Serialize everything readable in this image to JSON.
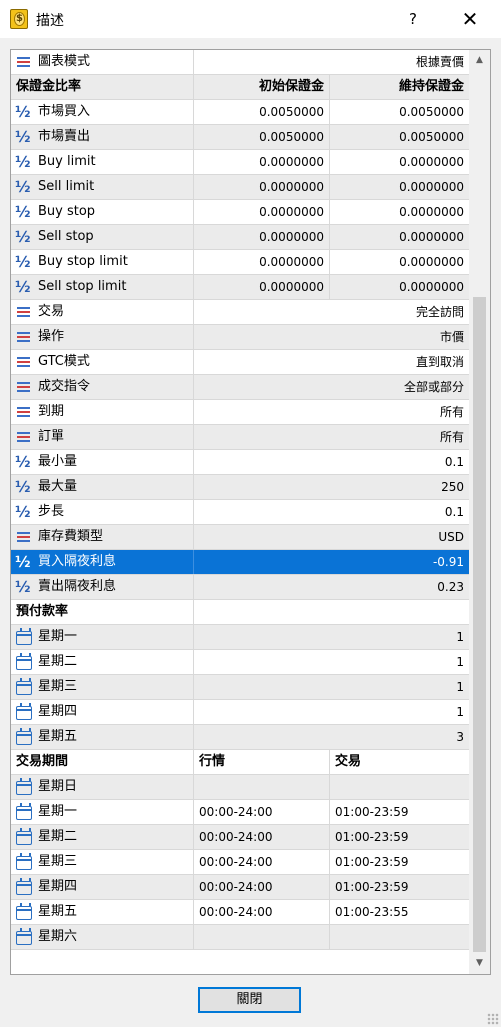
{
  "window": {
    "title": "描述",
    "help_label": "?",
    "close_label": "✕"
  },
  "rows": [
    {
      "kind": "prop",
      "icon": "list",
      "name": "圖表模式",
      "value": "根據賣價"
    },
    {
      "kind": "header",
      "name": "保證金比率",
      "a": "初始保證金",
      "b": "維持保證金"
    },
    {
      "kind": "pair",
      "icon": "half",
      "name": "市場買入",
      "a": "0.0050000",
      "b": "0.0050000"
    },
    {
      "kind": "pair",
      "icon": "half",
      "name": "市場賣出",
      "a": "0.0050000",
      "b": "0.0050000"
    },
    {
      "kind": "pair",
      "icon": "half",
      "name": "Buy limit",
      "a": "0.0000000",
      "b": "0.0000000"
    },
    {
      "kind": "pair",
      "icon": "half",
      "name": "Sell limit",
      "a": "0.0000000",
      "b": "0.0000000"
    },
    {
      "kind": "pair",
      "icon": "half",
      "name": "Buy stop",
      "a": "0.0000000",
      "b": "0.0000000"
    },
    {
      "kind": "pair",
      "icon": "half",
      "name": "Sell stop",
      "a": "0.0000000",
      "b": "0.0000000"
    },
    {
      "kind": "pair",
      "icon": "half",
      "name": "Buy stop limit",
      "a": "0.0000000",
      "b": "0.0000000"
    },
    {
      "kind": "pair",
      "icon": "half",
      "name": "Sell stop limit",
      "a": "0.0000000",
      "b": "0.0000000"
    },
    {
      "kind": "prop",
      "icon": "list",
      "name": "交易",
      "value": "完全訪問"
    },
    {
      "kind": "prop",
      "icon": "list",
      "name": "操作",
      "value": "市價"
    },
    {
      "kind": "prop",
      "icon": "list",
      "name": "GTC模式",
      "value": "直到取消"
    },
    {
      "kind": "prop",
      "icon": "list",
      "name": "成交指令",
      "value": "全部或部分"
    },
    {
      "kind": "prop",
      "icon": "list",
      "name": "到期",
      "value": "所有"
    },
    {
      "kind": "prop",
      "icon": "list",
      "name": "訂單",
      "value": "所有"
    },
    {
      "kind": "prop",
      "icon": "half",
      "name": "最小量",
      "value": "0.1"
    },
    {
      "kind": "prop",
      "icon": "half",
      "name": "最大量",
      "value": "250"
    },
    {
      "kind": "prop",
      "icon": "half",
      "name": "步長",
      "value": "0.1"
    },
    {
      "kind": "prop",
      "icon": "list",
      "name": "庫存費類型",
      "value": "USD"
    },
    {
      "kind": "prop",
      "icon": "half",
      "name": "買入隔夜利息",
      "value": "-0.91",
      "selected": true
    },
    {
      "kind": "prop",
      "icon": "half",
      "name": "賣出隔夜利息",
      "value": "0.23"
    },
    {
      "kind": "section",
      "name": "預付款率"
    },
    {
      "kind": "prop",
      "icon": "cal",
      "name": "星期一",
      "value": "1"
    },
    {
      "kind": "prop",
      "icon": "cal",
      "name": "星期二",
      "value": "1"
    },
    {
      "kind": "prop",
      "icon": "cal",
      "name": "星期三",
      "value": "1"
    },
    {
      "kind": "prop",
      "icon": "cal",
      "name": "星期四",
      "value": "1"
    },
    {
      "kind": "prop",
      "icon": "cal",
      "name": "星期五",
      "value": "3"
    },
    {
      "kind": "header",
      "name": "交易期間",
      "a": "行情",
      "b": "交易"
    },
    {
      "kind": "session",
      "icon": "cal",
      "name": "星期日",
      "a": "",
      "b": ""
    },
    {
      "kind": "session",
      "icon": "cal",
      "name": "星期一",
      "a": "00:00-24:00",
      "b": "01:00-23:59"
    },
    {
      "kind": "session",
      "icon": "cal",
      "name": "星期二",
      "a": "00:00-24:00",
      "b": "01:00-23:59"
    },
    {
      "kind": "session",
      "icon": "cal",
      "name": "星期三",
      "a": "00:00-24:00",
      "b": "01:00-23:59"
    },
    {
      "kind": "session",
      "icon": "cal",
      "name": "星期四",
      "a": "00:00-24:00",
      "b": "01:00-23:59"
    },
    {
      "kind": "session",
      "icon": "cal",
      "name": "星期五",
      "a": "00:00-24:00",
      "b": "01:00-23:55"
    },
    {
      "kind": "session",
      "icon": "cal",
      "name": "星期六",
      "a": "",
      "b": ""
    }
  ],
  "footer": {
    "close_button": "關閉"
  },
  "colors": {
    "selection": "#0a73d6",
    "alt_row": "#ebebeb"
  }
}
